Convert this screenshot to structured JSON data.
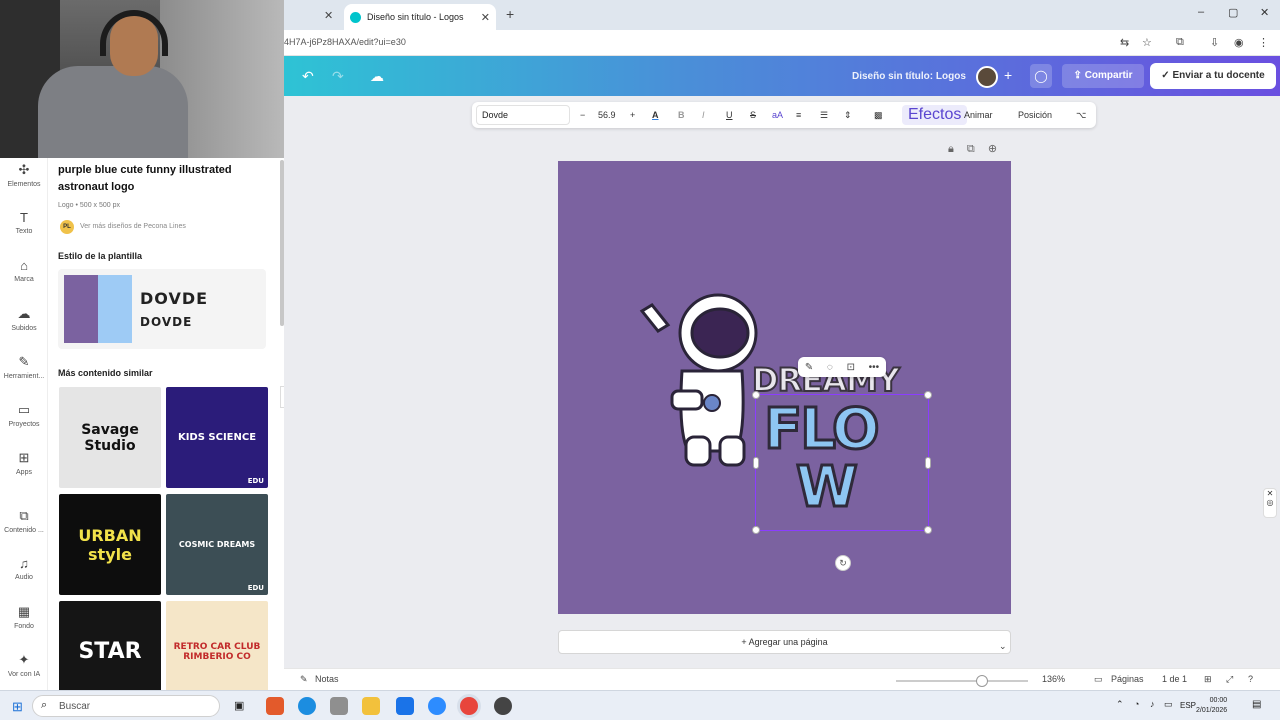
{
  "browser": {
    "tab_title": "Diseño sin título - Logos",
    "url": "4H7A-j6Pz8HAXA/edit?ui=e30"
  },
  "canva": {
    "doc_title": "Diseño sin título: Logos",
    "share_label": "Compartir",
    "send_label": "Enviar a tu docente"
  },
  "leftnav": [
    {
      "label": "Elementos",
      "icon": "elements-icon"
    },
    {
      "label": "Texto",
      "icon": "text-icon"
    },
    {
      "label": "Marca",
      "icon": "brand-icon"
    },
    {
      "label": "Subidos",
      "icon": "upload-icon"
    },
    {
      "label": "Herramient...",
      "icon": "tools-icon"
    },
    {
      "label": "Proyectos",
      "icon": "folder-icon"
    },
    {
      "label": "Apps",
      "icon": "apps-icon"
    },
    {
      "label": "Contenido ...",
      "icon": "content-icon"
    },
    {
      "label": "Audio",
      "icon": "audio-icon"
    },
    {
      "label": "Fondo",
      "icon": "background-icon"
    },
    {
      "label": "Vor con IA",
      "icon": "ai-icon"
    }
  ],
  "panel": {
    "title": "purple blue cute funny illustrated astronaut logo",
    "meta": "Logo • 500 x 500 px",
    "author_initials": "PL",
    "author": "Ver más diseños de Pecona Lines",
    "style_heading": "Estilo de la plantilla",
    "font_sample_1": "DOVDE",
    "font_sample_2": "DOVDE",
    "similar_heading": "Más contenido similar",
    "thumbs": [
      {
        "text": "Savage Studio",
        "bg": "#e5e5e5",
        "fg": "#111",
        "edu": ""
      },
      {
        "text": "KIDS SCIENCE",
        "bg": "#2b1c7a",
        "fg": "#fff",
        "edu": "EDU"
      },
      {
        "text": "URBAN style",
        "bg": "#0d0d0d",
        "fg": "#f2e24a",
        "edu": ""
      },
      {
        "text": "COSMIC DREAMS",
        "bg": "#3c4e55",
        "fg": "#fff",
        "edu": "EDU"
      },
      {
        "text": "STAR",
        "bg": "#151515",
        "fg": "#fff",
        "edu": ""
      },
      {
        "text": "RETRO CAR CLUB RIMBERIO CO",
        "bg": "#f5e6c8",
        "fg": "#c22b2b",
        "edu": ""
      }
    ]
  },
  "toolbar": {
    "font": "Dovde",
    "size": "56.9",
    "effects": "Efectos",
    "animate": "Animar",
    "position": "Posición"
  },
  "canvas": {
    "word1": "DREAMY",
    "word2": "FLO",
    "word3": "W",
    "bg": "#7b62a0"
  },
  "add_page": "+ Agregar una página",
  "bottom": {
    "notes": "Notas",
    "zoom": "136%",
    "pages": "Páginas",
    "page_count": "1 de 1"
  },
  "taskbar": {
    "search": "Buscar",
    "lang": "ESP",
    "time": "00:00",
    "date": "2/01/2026"
  }
}
